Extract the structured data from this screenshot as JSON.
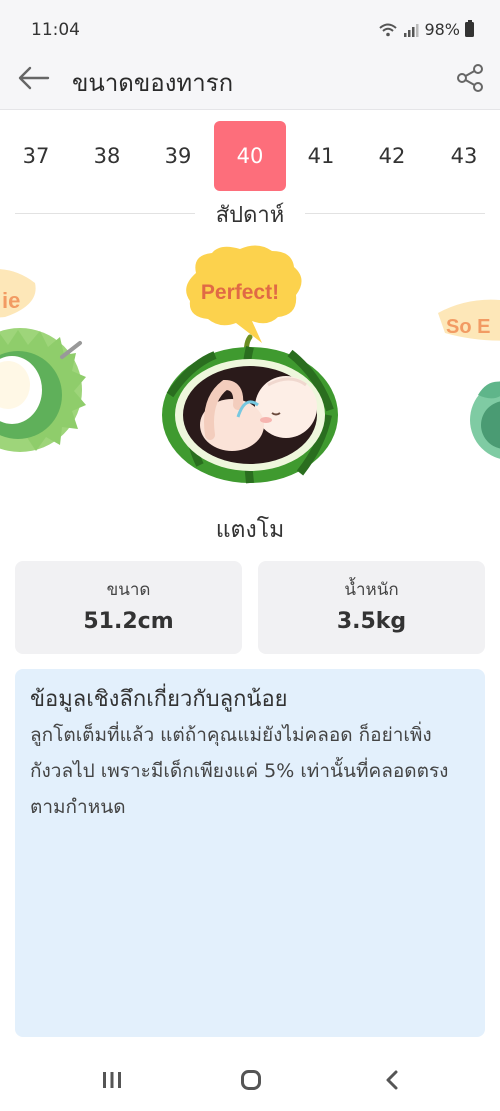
{
  "status": {
    "time": "11:04",
    "battery": "98%"
  },
  "header": {
    "title": "ขนาดของทารก"
  },
  "weeks": {
    "items": [
      "37",
      "38",
      "39",
      "40",
      "41",
      "42",
      "43"
    ],
    "active": "40",
    "label": "สัปดาห์"
  },
  "illustration": {
    "bubble_text": "Perfect!",
    "left_bubble_fragment": "ie",
    "right_bubble_fragment": "So E"
  },
  "fruit": {
    "name": "แตงโม"
  },
  "stats": {
    "size": {
      "label": "ขนาด",
      "value": "51.2cm"
    },
    "weight": {
      "label": "น้ำหนัก",
      "value": "3.5kg"
    }
  },
  "insight": {
    "title": "ข้อมูลเชิงลึกเกี่ยวกับลูกน้อย",
    "body": "ลูกโตเต็มที่แล้ว แต่ถ้าคุณแม่ยังไม่คลอด ก็อย่าเพิ่งกังวลไป เพราะมีเด็กเพียงแค่ 5% เท่านั้นที่คลอดตรงตามกำหนด"
  },
  "colors": {
    "accent": "#fd6e7b",
    "insight_bg": "#e3f0fc",
    "card_bg": "#f1f1f3",
    "bubble": "#fcd24d"
  },
  "icons": {
    "header": [
      "back-arrow-icon",
      "share-icon"
    ],
    "status": [
      "wifi-icon",
      "signal-icon",
      "battery-icon"
    ],
    "nav": [
      "recent-apps-icon",
      "home-icon",
      "back-icon"
    ]
  }
}
